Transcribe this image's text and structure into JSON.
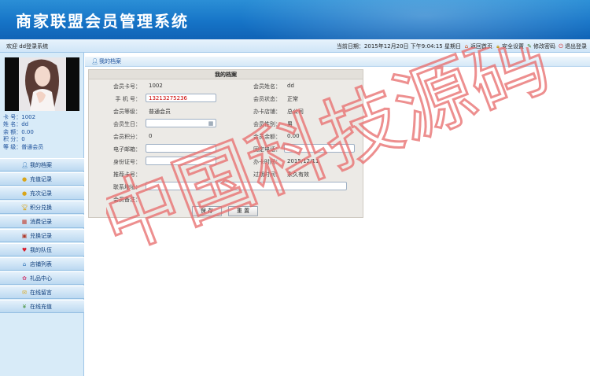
{
  "app": {
    "title": "商家联盟会员管理系统"
  },
  "topbar": {
    "welcome": "欢迎 dd登录系统",
    "datetime": "当前日期：2015年12月20日 下午9:04:15 星期日",
    "links": {
      "home": "返回首页",
      "security": "安全设置",
      "password": "修改密码",
      "logout": "退出登录"
    }
  },
  "sidebar": {
    "info": [
      {
        "label": "卡  号：",
        "value": "1002"
      },
      {
        "label": "姓  名：",
        "value": "dd"
      },
      {
        "label": "余  额：",
        "value": "0.00"
      },
      {
        "label": "积  分：",
        "value": "0"
      },
      {
        "label": "等  级：",
        "value": "普通会员"
      }
    ],
    "menu": [
      {
        "label": "我的档案",
        "icon": "user-icon"
      },
      {
        "label": "充值记录",
        "icon": "coins-icon"
      },
      {
        "label": "充次记录",
        "icon": "coins-icon"
      },
      {
        "label": "积分兑换",
        "icon": "trophy-icon"
      },
      {
        "label": "消费记录",
        "icon": "calendar-icon"
      },
      {
        "label": "兑换记录",
        "icon": "gift-box-icon"
      },
      {
        "label": "我的队伍",
        "icon": "heart-icon"
      },
      {
        "label": "店铺列表",
        "icon": "house-icon"
      },
      {
        "label": "礼品中心",
        "icon": "gift-icon"
      },
      {
        "label": "在线留言",
        "icon": "message-icon"
      },
      {
        "label": "在线充值",
        "icon": "money-bag-icon"
      }
    ]
  },
  "main": {
    "breadcrumb": "我的档案",
    "form_title": "我的档案",
    "fields": {
      "card_no": {
        "label": "会员卡号：",
        "value": "1002"
      },
      "member_name": {
        "label": "会员姓名：",
        "value": "dd"
      },
      "phone": {
        "label": "手 机 号：",
        "value": "13213275236"
      },
      "member_status": {
        "label": "会员状态：",
        "value": "正常"
      },
      "member_level": {
        "label": "会员等级：",
        "value": "普通会员"
      },
      "store": {
        "label": "办卡店铺：",
        "value": "总公司"
      },
      "birthday": {
        "label": "会员生日：",
        "value": ""
      },
      "gender": {
        "label": "会员性别：",
        "value": "男"
      },
      "points": {
        "label": "会员积分：",
        "value": "0"
      },
      "balance": {
        "label": "会员余额：",
        "value": "0.00"
      },
      "email": {
        "label": "电子邮箱：",
        "value": ""
      },
      "fixed_phone": {
        "label": "固定电话：",
        "value": ""
      },
      "id_card": {
        "label": "身份证号：",
        "value": ""
      },
      "issue_date": {
        "label": "办卡时间：",
        "value": "2015/12/11"
      },
      "referrer": {
        "label": "推荐卡号：",
        "value": ""
      },
      "expiry": {
        "label": "过期时间：",
        "value": "永久有效"
      },
      "address": {
        "label": "联系地址：",
        "value": ""
      },
      "remark": {
        "label": "会员备注：",
        "value": ""
      }
    },
    "save_label": "保  存",
    "reset_label": "重  置"
  },
  "watermark": "中国科技源码",
  "colors": {
    "header": "#1674c7",
    "watermark": "#e86a6a"
  }
}
